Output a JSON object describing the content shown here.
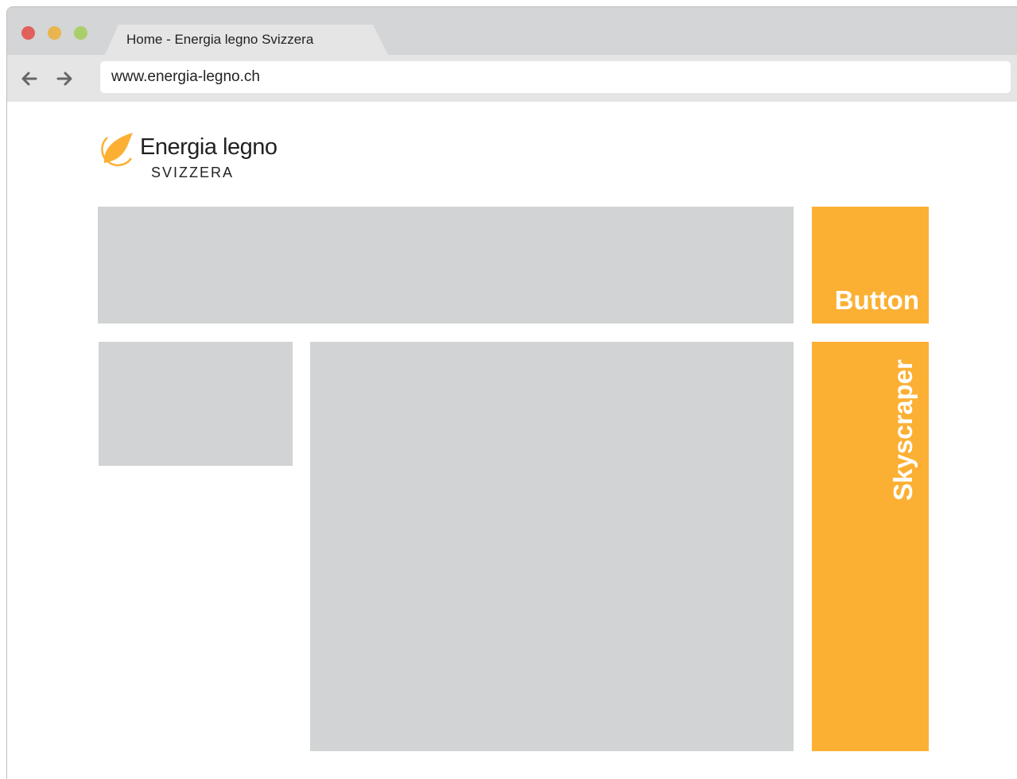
{
  "browser": {
    "tab_title": "Home - Energia legno Svizzera",
    "url": "www.energia-legno.ch",
    "icons": {
      "close": "traffic-light-close",
      "minimize": "traffic-light-minimize",
      "maximize": "traffic-light-maximize",
      "back": "arrow-left-icon",
      "forward": "arrow-right-icon"
    }
  },
  "logo": {
    "name": "Energia legno",
    "subtitle": "SVIZZERA",
    "icon": "flame-leaf-icon"
  },
  "ad_slots": {
    "button_label": "Button",
    "skyscraper_label": "Skyscraper"
  },
  "colors": {
    "accent_orange": "#fbb034",
    "placeholder_gray": "#d1d3d4",
    "close_red": "#e0615b",
    "minimize_yellow": "#e8b54f",
    "maximize_green": "#a9cf6b"
  }
}
